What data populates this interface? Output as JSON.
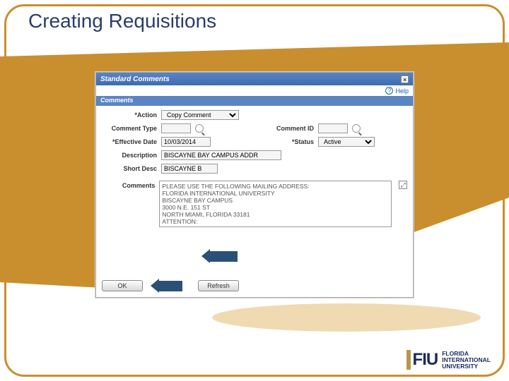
{
  "slide": {
    "title": "Creating Requisitions"
  },
  "dialog": {
    "title": "Standard Comments",
    "help_label": "Help"
  },
  "section": {
    "label": "Comments"
  },
  "form": {
    "action_label": "*Action",
    "action_value": "Copy Comment",
    "comment_type_label": "Comment Type",
    "comment_type_value": "",
    "comment_id_label": "Comment ID",
    "comment_id_value": "",
    "effective_date_label": "*Effective Date",
    "effective_date_value": "10/03/2014",
    "status_label": "*Status",
    "status_value": "Active",
    "description_label": "Description",
    "description_value": "BISCAYNE BAY CAMPUS ADDR",
    "short_desc_label": "Short Desc",
    "short_desc_value": "BISCAYNE B",
    "comments_label": "Comments",
    "comments_value": "PLEASE USE THE FOLLOWING MAILING ADDRESS:\nFLORIDA INTERNATIONAL UNIVERSITY\nBISCAYNE BAY CAMPUS\n3000 N.E. 151 ST\nNORTH MIAMI, FLORIDA 33181\nATTENTION:"
  },
  "buttons": {
    "ok": "OK",
    "refresh": "Refresh"
  },
  "logo": {
    "mark": "FIU",
    "line1": "FLORIDA",
    "line2": "INTERNATIONAL",
    "line3": "UNIVERSITY"
  }
}
